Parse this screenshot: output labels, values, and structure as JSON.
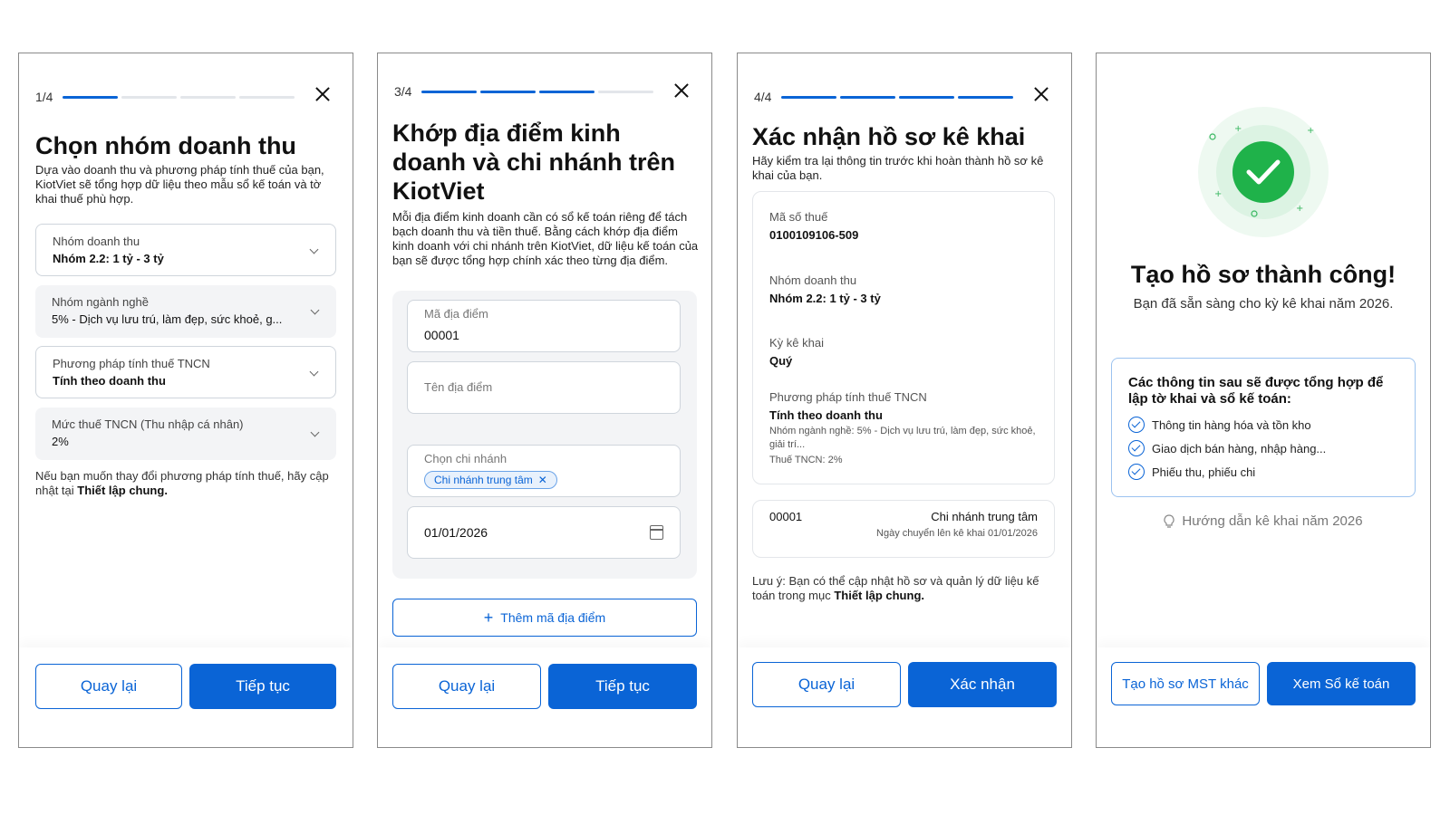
{
  "screen1": {
    "step": "1/4",
    "title": "Chọn nhóm doanh thu",
    "description": "Dựa vào doanh thu và phương pháp tính thuế của bạn, KiotViet sẽ tổng hợp dữ liệu theo mẫu sổ kế toán và tờ khai thuế phù hợp.",
    "fields": [
      {
        "label": "Nhóm doanh thu",
        "value": "Nhóm 2.2: 1 tỷ - 3 tỷ"
      },
      {
        "label": "Nhóm ngành nghề",
        "value": "5% - Dịch vụ lưu trú, làm đẹp, sức khoẻ, g..."
      },
      {
        "label": "Phương pháp tính thuế TNCN",
        "value": "Tính theo doanh thu"
      },
      {
        "label": "Mức thuế TNCN (Thu nhập cá nhân)",
        "value": "2%"
      }
    ],
    "note_prefix": "Nếu bạn muốn thay đổi phương pháp tính thuế, hãy cập nhật tại ",
    "note_link": "Thiết lập chung.",
    "back": "Quay lại",
    "next": "Tiếp tục"
  },
  "screen2": {
    "step": "3/4",
    "title": "Khớp địa điểm kinh doanh và chi nhánh trên KiotViet",
    "description": "Mỗi địa điểm kinh doanh cần có sổ kế toán riêng để tách bạch doanh thu và tiền thuế. Bằng cách khớp địa điểm kinh doanh với chi nhánh trên KiotViet, dữ liệu kế toán của bạn sẽ được tổng hợp chính xác theo từng địa điểm.",
    "location_code_label": "Mã địa điểm",
    "location_code_value": "00001",
    "location_name_placeholder": "Tên địa điểm",
    "branch_label": "Chọn chi nhánh",
    "branch_chip": "Chi nhánh trung tâm",
    "date_value": "01/01/2026",
    "add_label": "Thêm mã địa điểm",
    "back": "Quay lại",
    "next": "Tiếp tục"
  },
  "screen3": {
    "step": "4/4",
    "title": "Xác nhận hồ sơ kê khai",
    "description": "Hãy kiểm tra lại thông tin trước khi hoàn thành hồ sơ kê khai của bạn.",
    "tax_code_label": "Mã số thuế",
    "tax_code_value": "0100109106-509",
    "revenue_group_label": "Nhóm doanh thu",
    "revenue_group_value": "Nhóm 2.2: 1 tỷ - 3 tỷ",
    "period_label": "Kỳ kê khai",
    "period_value": "Quý",
    "method_label": "Phương pháp tính thuế TNCN",
    "method_value": "Tính theo doanh thu",
    "industry_detail": "Nhóm ngành nghề: 5% - Dịch vụ lưu trú, làm đẹp, sức khoẻ, giải trí...",
    "tax_rate_detail": "Thuế TNCN: 2%",
    "location_code": "00001",
    "branch_name": "Chi nhánh trung tâm",
    "transfer_date": "Ngày chuyển lên kê khai 01/01/2026",
    "note_prefix": "Lưu ý: Bạn có thể cập nhật hồ sơ và quản lý dữ liệu kế toán trong mục ",
    "note_link": "Thiết lập chung.",
    "back": "Quay lại",
    "confirm": "Xác nhận"
  },
  "screen4": {
    "title": "Tạo hồ sơ thành công!",
    "subtitle": "Bạn đã sẵn sàng cho kỳ kê khai năm 2026.",
    "info_heading": "Các thông tin sau sẽ được tổng hợp để lập tờ khai và sổ kế toán:",
    "items": [
      "Thông tin hàng hóa và tồn kho",
      "Giao dịch bán hàng, nhập hàng...",
      "Phiếu thu, phiếu chi"
    ],
    "guide": "Hướng dẫn kê khai năm 2026",
    "create_other": "Tạo hồ sơ MST khác",
    "view_books": "Xem Sổ kế toán"
  },
  "colors": {
    "primary": "#0a64d6",
    "success": "#1fb24a"
  }
}
